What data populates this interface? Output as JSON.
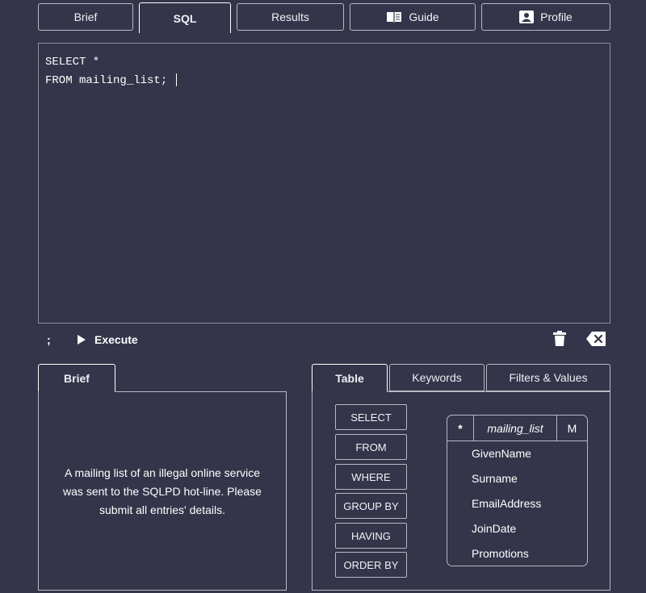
{
  "top_tabs": [
    {
      "label": "Brief"
    },
    {
      "label": "SQL"
    },
    {
      "label": "Results"
    },
    {
      "label": "Guide"
    },
    {
      "label": "Profile"
    }
  ],
  "editor": {
    "lines": [
      "SELECT *",
      "FROM mailing_list; "
    ]
  },
  "toolbar": {
    "semicolon_label": ";",
    "execute_label": "Execute"
  },
  "brief_panel": {
    "tab_label": "Brief",
    "text": "A mailing list of an illegal online service was sent to the SQLPD hot-line. Please submit all entries' details."
  },
  "helper_panel": {
    "tabs": [
      {
        "label": "Table"
      },
      {
        "label": "Keywords"
      },
      {
        "label": "Filters & Values"
      }
    ],
    "keywords": [
      "SELECT",
      "FROM",
      "WHERE",
      "GROUP BY",
      "HAVING",
      "ORDER BY"
    ],
    "table": {
      "star": "*",
      "name": "mailing_list",
      "m": "M",
      "columns": [
        "GivenName",
        "Surname",
        "EmailAddress",
        "JoinDate",
        "Promotions"
      ]
    }
  },
  "colors": {
    "background": "#34344a",
    "border": "#b9b9c4",
    "text": "#ffffff"
  }
}
